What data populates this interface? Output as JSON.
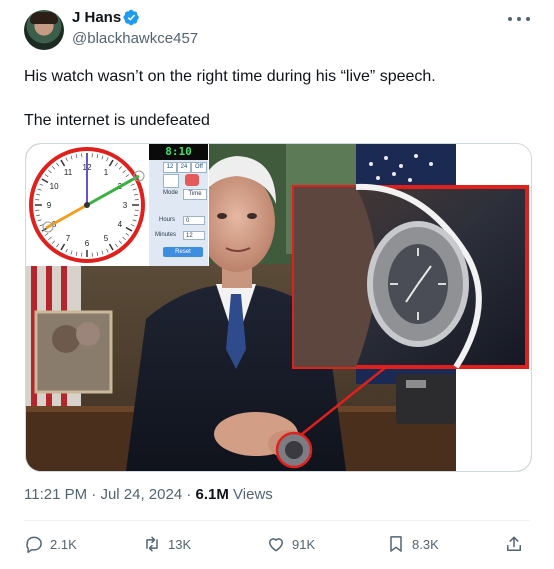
{
  "author": {
    "name": "J Hans",
    "handle": "@blackhawkce457"
  },
  "tweet": {
    "line1": "His watch wasn’t on the right time during his “live” speech.",
    "line2": "The internet is undefeated"
  },
  "clock_widget": {
    "digital_time": "8:10",
    "format_12": "12",
    "format_24": "24",
    "format_off": "Off",
    "mode_label": "Mode",
    "mode_value": "Time",
    "hours_label": "Hours",
    "hours_value": "0",
    "minutes_label": "Minutes",
    "minutes_value": "12",
    "reset_label": "Reset",
    "numbers": [
      "12",
      "1",
      "2",
      "3",
      "4",
      "5",
      "6",
      "7",
      "8",
      "9",
      "10",
      "11"
    ]
  },
  "meta": {
    "time": "11:21 PM",
    "separator": "·",
    "date": "Jul 24, 2024",
    "views_count": "6.1M",
    "views_label": "Views"
  },
  "actions": {
    "replies": "2.1K",
    "reposts": "13K",
    "likes": "91K",
    "bookmarks": "8.3K"
  },
  "colors": {
    "accent": "#1d9bf0",
    "highlight_red": "#e0201c",
    "secondary_text": "#536471"
  }
}
